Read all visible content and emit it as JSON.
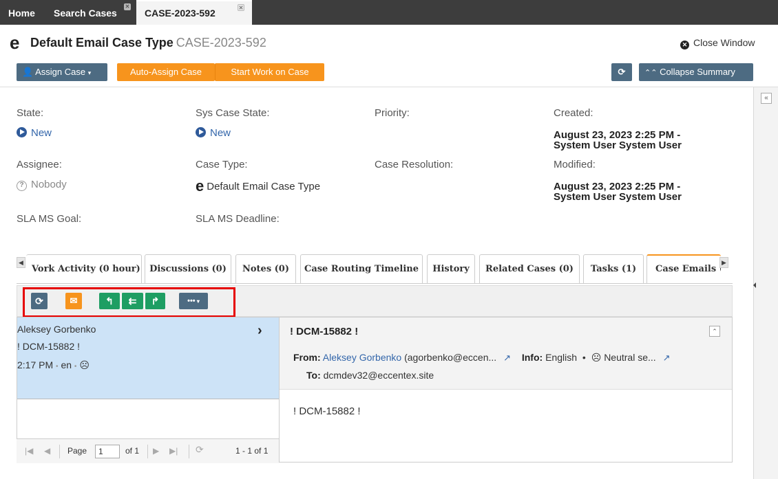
{
  "top_tabs": [
    {
      "label": "Home"
    },
    {
      "label": "Search Cases"
    },
    {
      "label": "CASE-2023-592"
    }
  ],
  "header": {
    "case_type_name": "Default Email Case Type",
    "case_number": "CASE-2023-592",
    "close_window": "Close Window"
  },
  "actions": {
    "assign_case": "Assign Case",
    "auto_assign": "Auto-Assign Case",
    "start_work": "Start Work on Case",
    "collapse_summary": "Collapse Summary"
  },
  "summary": {
    "state_label": "State:",
    "state_value": "New",
    "sys_state_label": "Sys Case State:",
    "sys_state_value": "New",
    "priority_label": "Priority:",
    "created_label": "Created:",
    "created_line1": "August 23, 2023 2:25 PM -",
    "created_line2": "System User System User",
    "assignee_label": "Assignee:",
    "assignee_value": "Nobody",
    "case_type_label": "Case Type:",
    "case_type_value": "Default Email Case Type",
    "resolution_label": "Case Resolution:",
    "modified_label": "Modified:",
    "modified_line1": "August 23, 2023 2:25 PM -",
    "modified_line2": "System User System User",
    "sla_goal_label": "SLA MS Goal:",
    "sla_deadline_label": "SLA MS Deadline:"
  },
  "detail_tabs": [
    {
      "label": "Vork Activity (0 hour)"
    },
    {
      "label": "Discussions (0)"
    },
    {
      "label": "Notes (0)"
    },
    {
      "label": "Case Routing Timeline"
    },
    {
      "label": "History"
    },
    {
      "label": "Related Cases (0)"
    },
    {
      "label": "Tasks (1)"
    },
    {
      "label": "Case Emails ("
    }
  ],
  "email_list": {
    "items": [
      {
        "sender": "Aleksey Gorbenko",
        "subject": "! DCM-15882 !",
        "time": "2:17 PM",
        "lang": "en"
      }
    ],
    "pager": {
      "page_label": "Page",
      "page_value": "1",
      "of_label": "of 1",
      "range": "1 - 1 of 1"
    }
  },
  "email_detail": {
    "subject": "! DCM-15882 !",
    "from_label": "From:",
    "from_name": "Aleksey Gorbenko",
    "from_email": "(agorbenko@eccen...",
    "info_label": "Info:",
    "info_lang": "English",
    "info_sentiment": "Neutral se...",
    "to_label": "To:",
    "to_value": "dcmdev32@eccentex.site",
    "body": "! DCM-15882 !"
  },
  "colors": {
    "accent_orange": "#f7941d",
    "slate_button": "#4d6b82",
    "green_button": "#1e9e63",
    "highlight_red": "#e60000",
    "link_blue": "#3366aa"
  }
}
